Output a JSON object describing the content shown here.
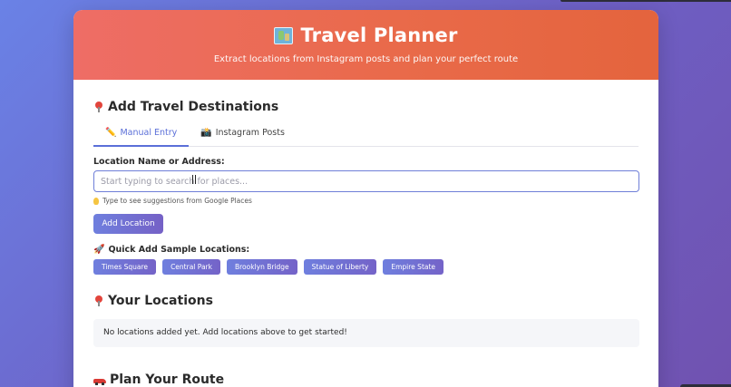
{
  "header": {
    "title": "Travel Planner",
    "subtitle": "Extract locations from Instagram posts and plan your perfect route",
    "icon": "world-map-icon"
  },
  "add_section": {
    "title": "Add Travel Destinations",
    "icon": "pin-icon",
    "tabs": [
      {
        "label": "Manual Entry",
        "icon": "pencil-icon",
        "active": true
      },
      {
        "label": "Instagram Posts",
        "icon": "camera-icon",
        "active": false
      }
    ],
    "field_label": "Location Name or Address:",
    "input_value": "",
    "input_placeholder": "Start typing to search for places...",
    "hint": "Type to see suggestions from Google Places",
    "add_button": "Add Location",
    "quick_label": "Quick Add Sample Locations:",
    "samples": [
      "Times Square",
      "Central Park",
      "Brooklyn Bridge",
      "Statue of Liberty",
      "Empire State"
    ]
  },
  "locations_section": {
    "title": "Your Locations",
    "empty_message": "No locations added yet. Add locations above to get started!"
  },
  "route_section": {
    "title": "Plan Your Route"
  },
  "colors": {
    "accent": "#5b6fd8",
    "header_start": "#ee6d66",
    "header_end": "#e4643d"
  }
}
